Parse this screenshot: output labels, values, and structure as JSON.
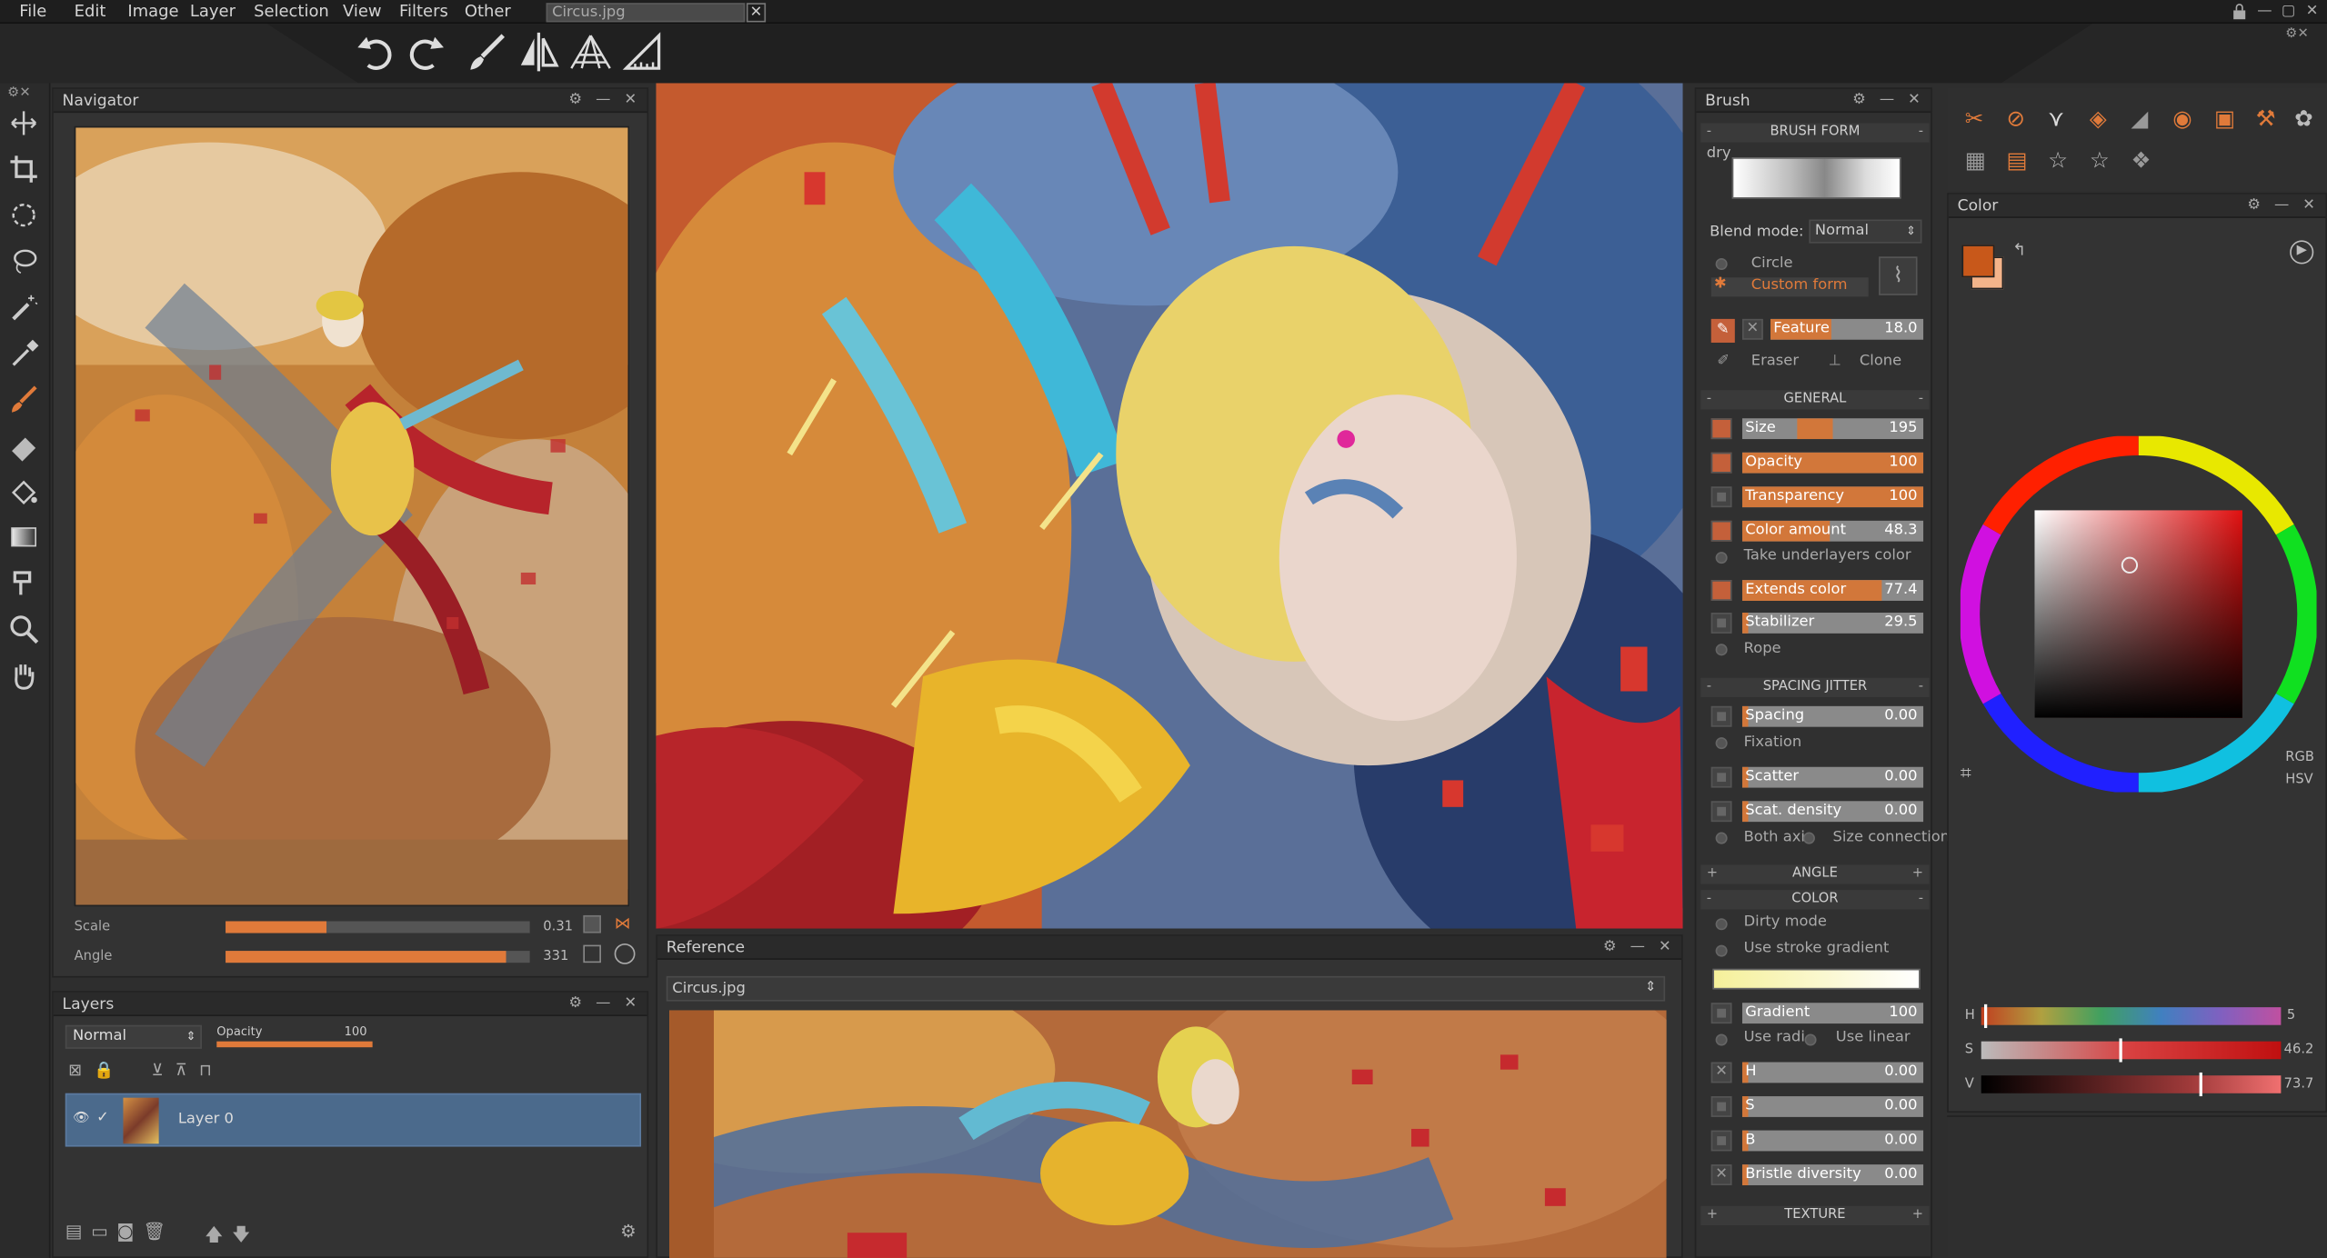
{
  "menu": {
    "items": [
      "File",
      "Edit",
      "Image",
      "Layer",
      "Selection",
      "View",
      "Filters",
      "Other"
    ],
    "document_tab": "Circus.jpg"
  },
  "navigator": {
    "title": "Navigator",
    "scale_label": "Scale",
    "scale_value": "0.31",
    "scale_fraction": 0.33,
    "angle_label": "Angle",
    "angle_value": "331",
    "angle_fraction": 0.92
  },
  "layers": {
    "title": "Layers",
    "blend_mode": "Normal",
    "opacity_label": "Opacity",
    "opacity_value": "100",
    "layer_name": "Layer 0"
  },
  "reference": {
    "title": "Reference",
    "file": "Circus.jpg"
  },
  "brush": {
    "title": "Brush",
    "brush_form_header": "BRUSH FORM",
    "brush_name": "dry",
    "blend_mode_label": "Blend mode:",
    "blend_mode_value": "Normal",
    "circle_label": "Circle",
    "custom_form_label": "Custom form",
    "feature_label": "Feature",
    "feature_value": "18.0",
    "eraser_label": "Eraser",
    "clone_label": "Clone",
    "general_header": "GENERAL",
    "size_label": "Size",
    "size_value": "195",
    "size_fraction": 0.2,
    "opacity_label": "Opacity",
    "opacity_value": "100",
    "transparency_label": "Transparency",
    "transparency_value": "100",
    "color_amount_label": "Color amount",
    "color_amount_value": "48.3",
    "take_underlayers_label": "Take underlayers color",
    "extends_color_label": "Extends color",
    "extends_color_value": "77.4",
    "stabilizer_label": "Stabilizer",
    "stabilizer_value": "29.5",
    "rope_label": "Rope",
    "spacing_jitter_header": "SPACING JITTER",
    "spacing_label": "Spacing",
    "spacing_value": "0.00",
    "fixation_label": "Fixation",
    "scatter_label": "Scatter",
    "scatter_value": "0.00",
    "scat_density_label": "Scat. density",
    "scat_density_value": "0.00",
    "both_axis_label": "Both axi",
    "size_connection_label": "Size connection",
    "angle_header": "ANGLE",
    "color_header": "COLOR",
    "dirty_mode_label": "Dirty mode",
    "use_stroke_gradient_label": "Use stroke gradient",
    "gradient_label": "Gradient",
    "gradient_value": "100",
    "use_radial_label": "Use radi",
    "use_linear_label": "Use linear",
    "h_label": "H",
    "h_value": "0.00",
    "s_label": "S",
    "s_value": "0.00",
    "b_label": "B",
    "b_value": "0.00",
    "bristle_label": "Bristle diversity",
    "bristle_value": "0.00",
    "texture_header": "TEXTURE"
  },
  "color": {
    "title": "Color",
    "current": "#c8581a",
    "rgb_label": "RGB",
    "hsv_label": "HSV",
    "h_label": "H",
    "h_value": "5",
    "s_label": "S",
    "s_value": "46.2",
    "v_label": "V",
    "v_value": "73.7"
  },
  "icons": {
    "toolbar": [
      "undo-icon",
      "redo-icon",
      "brush-icon",
      "symmetry-icon",
      "perspective-icon",
      "ruler-icon"
    ],
    "tools": [
      "move-icon",
      "crop-icon",
      "ellipse-select-icon",
      "lasso-icon",
      "magic-wand-icon",
      "eyedropper-icon",
      "brush-tool-icon",
      "eraser-icon",
      "fill-icon",
      "gradient-icon",
      "smudge-icon",
      "zoom-icon",
      "hand-icon"
    ]
  }
}
